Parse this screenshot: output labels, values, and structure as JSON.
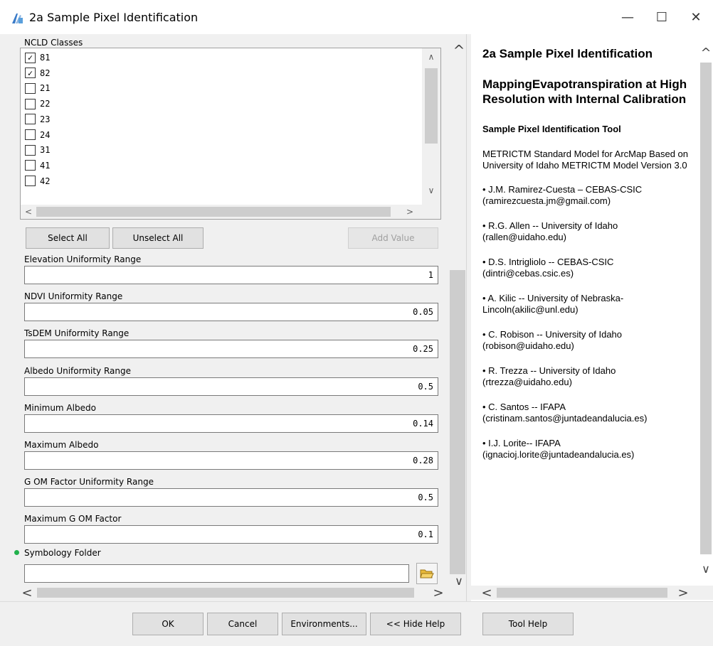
{
  "window": {
    "title": "2a Sample Pixel Identification",
    "minimize_glyph": "—",
    "maximize_glyph": "☐",
    "close_glyph": "✕"
  },
  "params": {
    "ncld_label": "NCLD Classes",
    "ncld_items": [
      {
        "value": "81",
        "checked": true
      },
      {
        "value": "82",
        "checked": true
      },
      {
        "value": "21",
        "checked": false
      },
      {
        "value": "22",
        "checked": false
      },
      {
        "value": "23",
        "checked": false
      },
      {
        "value": "24",
        "checked": false
      },
      {
        "value": "31",
        "checked": false
      },
      {
        "value": "41",
        "checked": false
      },
      {
        "value": "42",
        "checked": false
      }
    ],
    "select_all": "Select All",
    "unselect_all": "Unselect All",
    "add_value": "Add Value",
    "fields": [
      {
        "label": "Elevation Uniformity Range",
        "value": "1"
      },
      {
        "label": "NDVI Uniformity Range",
        "value": "0.05"
      },
      {
        "label": "TsDEM Uniformity Range",
        "value": "0.25"
      },
      {
        "label": "Albedo Uniformity Range",
        "value": "0.5"
      },
      {
        "label": "Minimum Albedo",
        "value": "0.14"
      },
      {
        "label": "Maximum Albedo",
        "value": "0.28"
      },
      {
        "label": "G OM Factor Uniformity Range",
        "value": "0.5"
      },
      {
        "label": "Maximum G OM Factor",
        "value": "0.1"
      }
    ],
    "symbology_label": "Symbology Folder",
    "symbology_value": ""
  },
  "help": {
    "title": "2a Sample Pixel Identification",
    "heading": "MappingEvapotranspiration at High Resolution with Internal Calibration",
    "subheading": "Sample Pixel Identification Tool",
    "description": "METRICTM Standard Model for ArcMap Based on University of Idaho METRICTM Model Version 3.0",
    "authors": [
      "• J.M. Ramirez-Cuesta – CEBAS-CSIC (ramirezcuesta.jm@gmail.com)",
      "• R.G. Allen -- University of Idaho (rallen@uidaho.edu)",
      "• D.S. Intrigliolo -- CEBAS-CSIC (dintri@cebas.csic.es)",
      "• A. Kilic -- University of Nebraska-Lincoln(akilic@unl.edu)",
      "• C. Robison -- University of Idaho (robison@uidaho.edu)",
      "• R. Trezza -- University of Idaho (rtrezza@uidaho.edu)",
      "• C. Santos -- IFAPA (cristinam.santos@juntadeandalucia.es)",
      "• I.J. Lorite-- IFAPA (ignacioj.lorite@juntadeandalucia.es)"
    ]
  },
  "buttons": {
    "ok": "OK",
    "cancel": "Cancel",
    "environments": "Environments...",
    "hide_help": "<< Hide Help",
    "tool_help": "Tool Help"
  },
  "colors": {
    "required_dot": "#22b14c",
    "folder_icon": "#e8b93a"
  }
}
